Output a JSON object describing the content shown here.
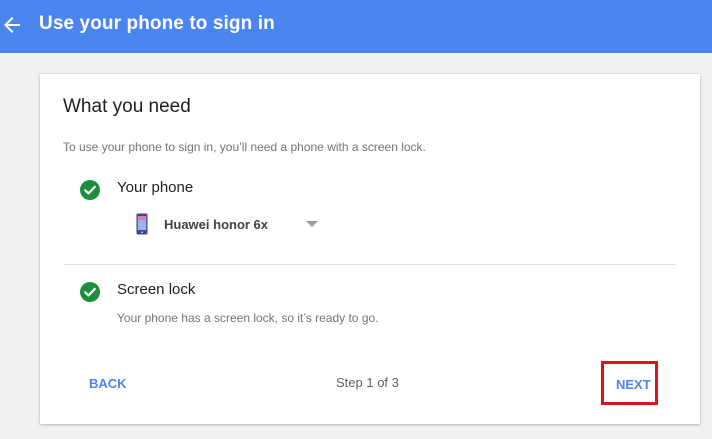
{
  "header": {
    "title": "Use your phone to sign in",
    "back_icon": "arrow-back-icon",
    "background": "#4a85f0"
  },
  "card": {
    "title": "What you need",
    "description": "To use your phone to sign in, you’ll need a phone with a screen lock.",
    "requirements": [
      {
        "label": "Your phone",
        "status": "complete",
        "icon": "check-circle-icon"
      },
      {
        "label": "Screen lock",
        "status": "complete",
        "icon": "check-circle-icon",
        "detail": "Your phone has a screen lock, so it’s ready to go."
      }
    ],
    "device_select": {
      "selected": "Huawei honor 6x",
      "icon": "phone-icon"
    }
  },
  "footer": {
    "back_label": "BACK",
    "step_text": "Step 1 of 3",
    "next_label": "NEXT"
  },
  "colors": {
    "accent": "#4a85f0",
    "success": "#1e8e3e",
    "highlight_border": "#d9141f"
  }
}
